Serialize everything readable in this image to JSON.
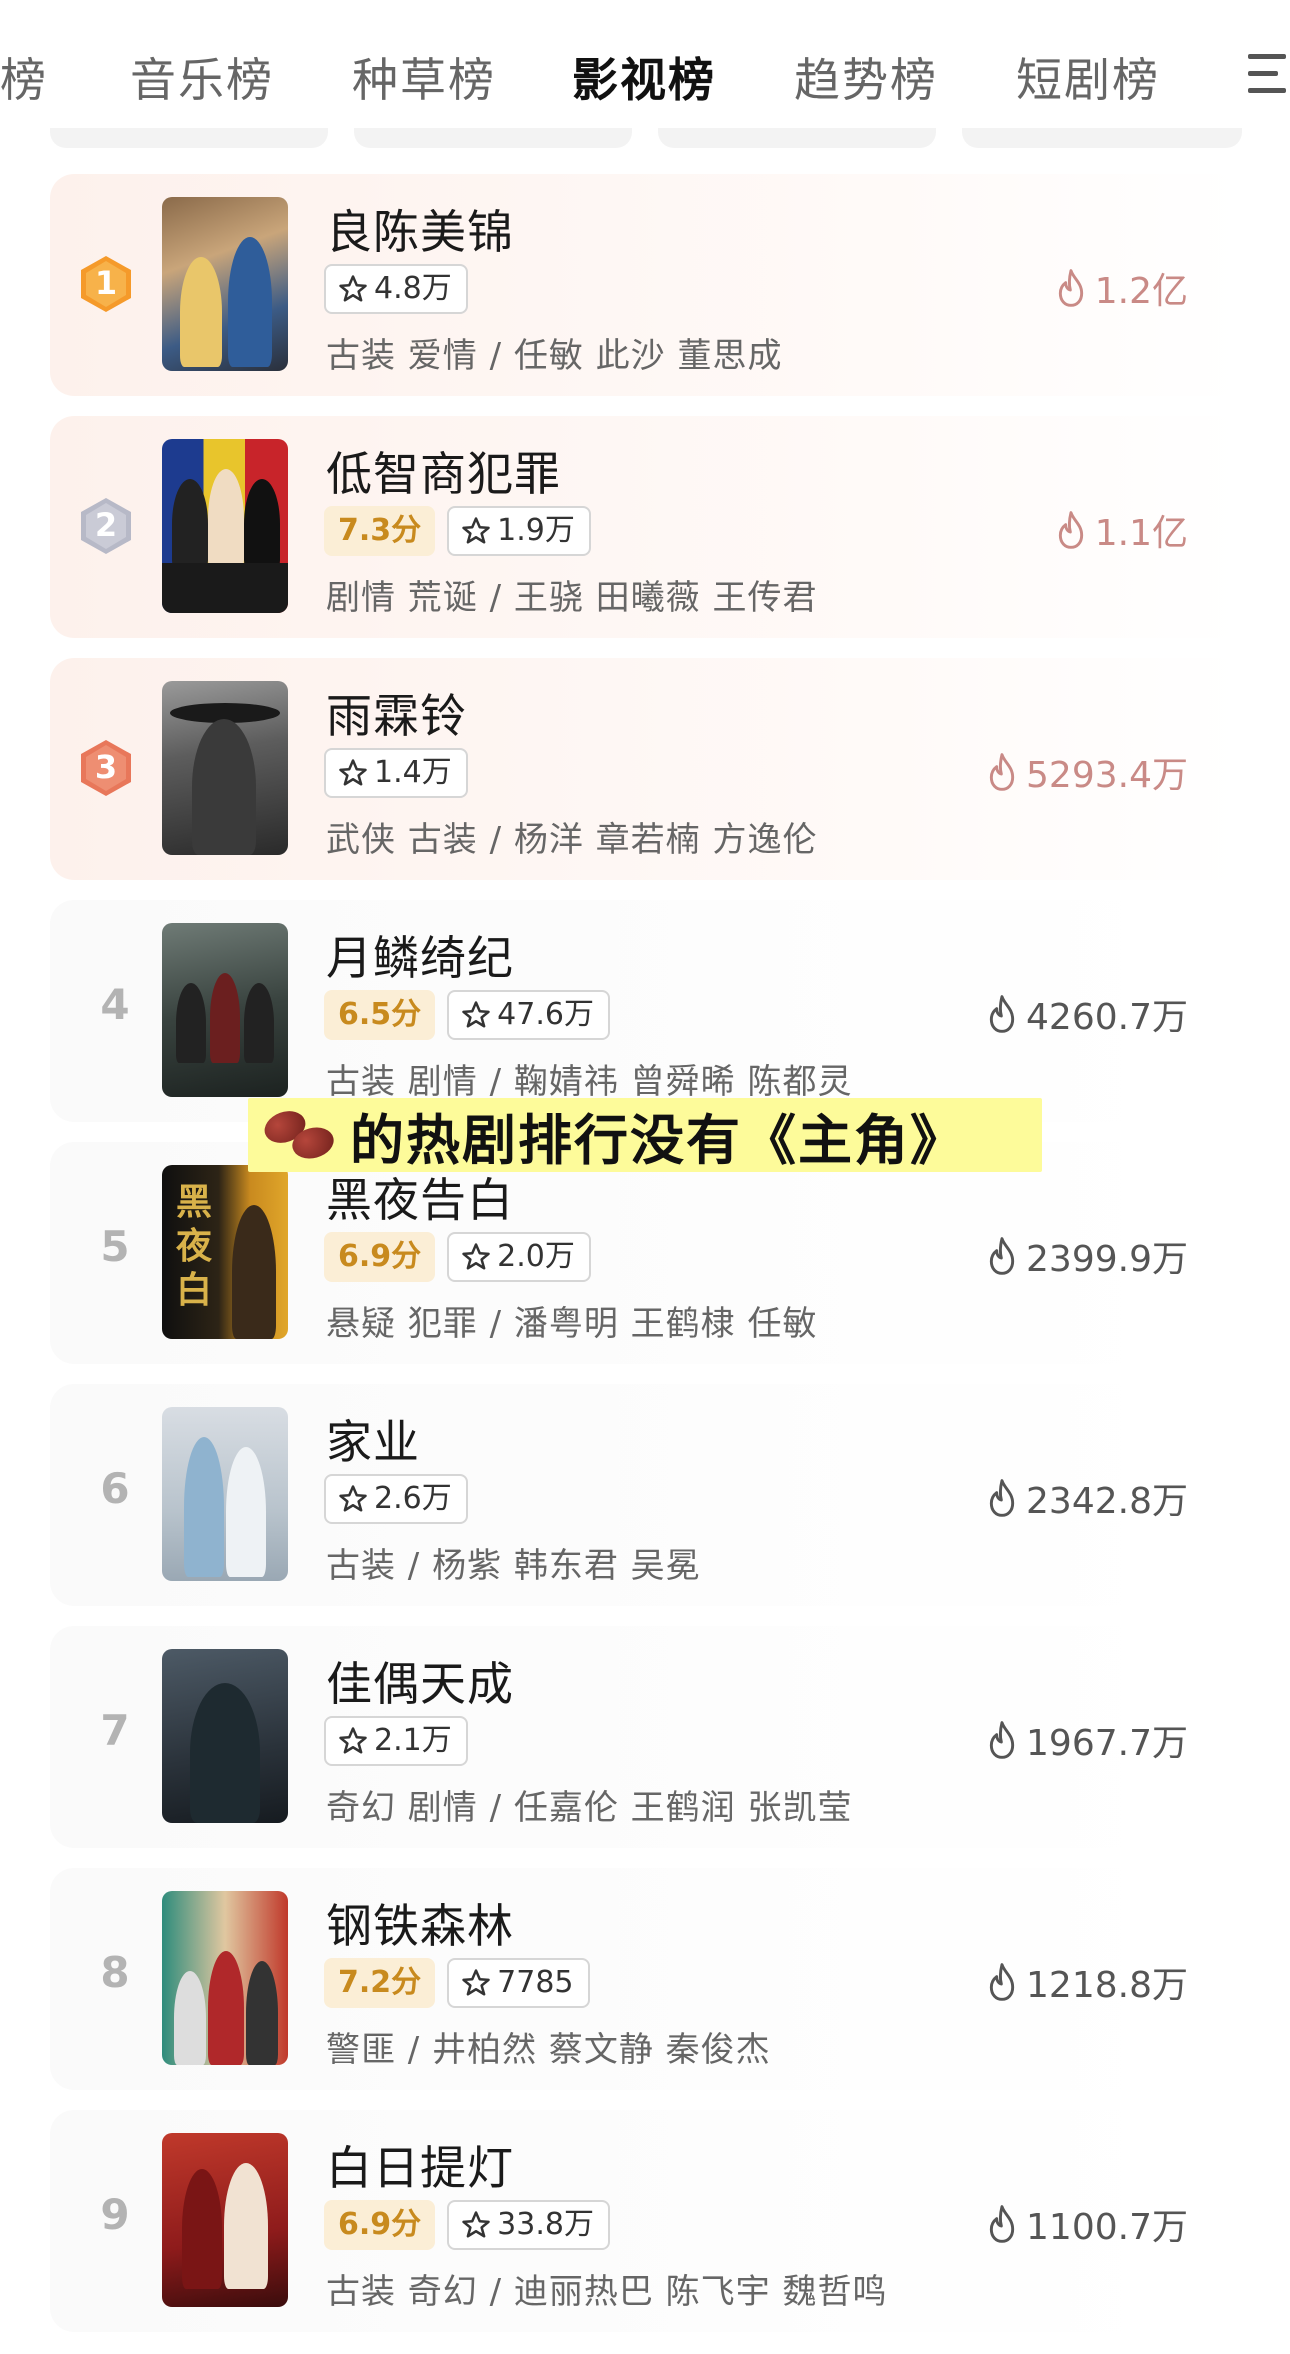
{
  "tabs": [
    {
      "label": "榜",
      "active": false
    },
    {
      "label": "音乐榜",
      "active": false
    },
    {
      "label": "种草榜",
      "active": false
    },
    {
      "label": "影视榜",
      "active": true
    },
    {
      "label": "趋势榜",
      "active": false
    },
    {
      "label": "短剧榜",
      "active": false
    }
  ],
  "overlay_caption": "的热剧排行没有《主角》",
  "rows": [
    {
      "rank": "1",
      "title": "良陈美锦",
      "score": "",
      "likes": "4.8万",
      "meta": "古装 爱情 / 任敏 此沙 董思成",
      "heat": "1.2亿",
      "poster_caption": "良陈美锦",
      "medal_color": "#f59a2a"
    },
    {
      "rank": "2",
      "title": "低智商犯罪",
      "score": "7.3分",
      "likes": "1.9万",
      "meta": "剧情 荒诞 / 王骁 田曦薇 王传君",
      "heat": "1.1亿",
      "poster_caption": "低智商犯罪",
      "medal_color": "#b7b9c7"
    },
    {
      "rank": "3",
      "title": "雨霖铃",
      "score": "",
      "likes": "1.4万",
      "meta": "武侠 古装 / 杨洋 章若楠 方逸伦",
      "heat": "5293.4万",
      "poster_caption": "雨霖铃",
      "medal_color": "#e8775a"
    },
    {
      "rank": "4",
      "title": "月鳞绮纪",
      "score": "6.5分",
      "likes": "47.6万",
      "meta": "古装 剧情 / 鞠婧祎 曾舜晞 陈都灵",
      "heat": "4260.7万",
      "poster_caption": "月鳞绮纪"
    },
    {
      "rank": "5",
      "title": "黑夜告白",
      "score": "6.9分",
      "likes": "2.0万",
      "meta": "悬疑 犯罪 / 潘粤明 王鹤棣 任敏",
      "heat": "2399.9万",
      "poster_caption": "黑夜告白"
    },
    {
      "rank": "6",
      "title": "家业",
      "score": "",
      "likes": "2.6万",
      "meta": "古装 / 杨紫 韩东君 吴冕",
      "heat": "2342.8万",
      "poster_caption": "家业"
    },
    {
      "rank": "7",
      "title": "佳偶天成",
      "score": "",
      "likes": "2.1万",
      "meta": "奇幻 剧情 / 任嘉伦 王鹤润 张凯莹",
      "heat": "1967.7万",
      "poster_caption": "佳偶天成"
    },
    {
      "rank": "8",
      "title": "钢铁森林",
      "score": "7.2分",
      "likes": "7785",
      "meta": "警匪 / 井柏然 蔡文静 秦俊杰",
      "heat": "1218.8万",
      "poster_caption": "钢铁森林"
    },
    {
      "rank": "9",
      "title": "白日提灯",
      "score": "6.9分",
      "likes": "33.8万",
      "meta": "古装 奇幻 / 迪丽热巴 陈飞宇 魏哲鸣",
      "heat": "1100.7万",
      "poster_caption": "白日提灯"
    }
  ]
}
